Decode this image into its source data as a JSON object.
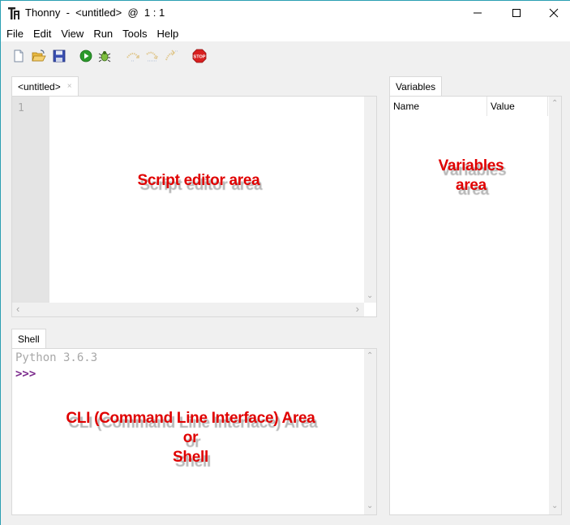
{
  "window": {
    "title": "Thonny  -  <untitled>  @  1 : 1",
    "controls": {
      "minimize": "minimize-icon",
      "maximize": "maximize-icon",
      "close": "close-icon"
    }
  },
  "menu": [
    {
      "label": "File"
    },
    {
      "label": "Edit"
    },
    {
      "label": "View"
    },
    {
      "label": "Run"
    },
    {
      "label": "Tools"
    },
    {
      "label": "Help"
    }
  ],
  "toolbar": [
    {
      "name": "new-file",
      "icon": "new-file-icon"
    },
    {
      "name": "open-file",
      "icon": "open-folder-icon"
    },
    {
      "name": "save-file",
      "icon": "save-floppy-icon"
    },
    {
      "name": "run",
      "icon": "run-play-icon"
    },
    {
      "name": "debug",
      "icon": "debug-bug-icon"
    },
    {
      "name": "step-over",
      "icon": "step-over-icon",
      "disabled": true
    },
    {
      "name": "step-into",
      "icon": "step-into-icon",
      "disabled": true
    },
    {
      "name": "step-out",
      "icon": "step-out-icon",
      "disabled": true
    },
    {
      "name": "stop",
      "icon": "stop-sign-icon",
      "label": "STOP"
    }
  ],
  "editor": {
    "tab_label": "<untitled>",
    "tab_close": "×",
    "line_numbers": [
      "1"
    ],
    "annotation": "Script editor area"
  },
  "shell": {
    "tab_label": "Shell",
    "version_line": "Python 3.6.3",
    "prompt": ">>>",
    "annotation_lines": [
      "CLI (Command Line Interface) Area",
      "or",
      "Shell"
    ]
  },
  "variables": {
    "tab_label": "Variables",
    "columns": [
      "Name",
      "Value"
    ],
    "rows": [],
    "annotation_lines": [
      "Variables",
      "area"
    ]
  },
  "colors": {
    "annotation": "#e00000",
    "prompt": "#7b2a8c",
    "shell_version": "#a8a8a8",
    "accent_border": "#2b9fb2"
  }
}
